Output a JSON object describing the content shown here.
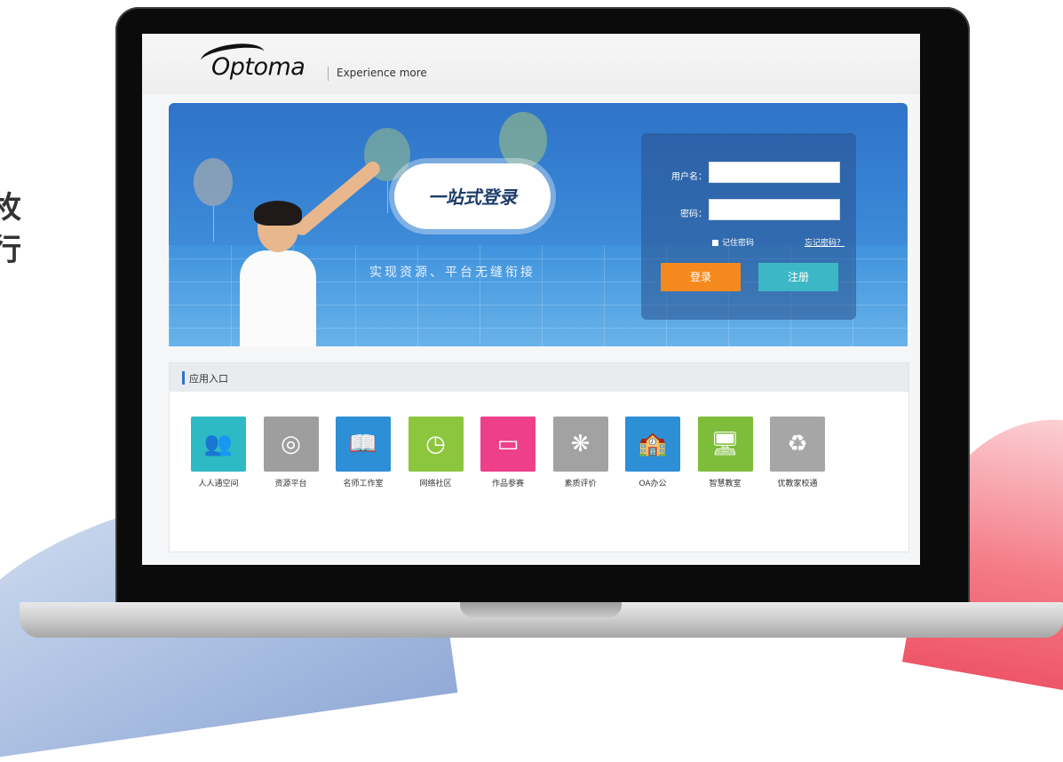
{
  "side_text": [
    "枚",
    "行"
  ],
  "header": {
    "logo": "Optoma",
    "tagline": "Experience more"
  },
  "banner": {
    "cloud_text": "一站式登录",
    "slogan": "实现资源、平台无缝衔接"
  },
  "login": {
    "username_label": "用户名：",
    "password_label": "密码：",
    "username_value": "",
    "password_value": "",
    "remember_label": "记住密码",
    "forgot_label": "忘记密码？",
    "login_button": "登录",
    "register_button": "注册"
  },
  "apps": {
    "title": "应用入口",
    "items": [
      {
        "label": "人人通空间",
        "icon": "users-icon",
        "glyph": "👥",
        "color": "#2ebac4"
      },
      {
        "label": "资源平台",
        "icon": "disc-icon",
        "glyph": "◎",
        "color": "#9e9e9e"
      },
      {
        "label": "名师工作室",
        "icon": "book-icon",
        "glyph": "📖",
        "color": "#2d8fd6"
      },
      {
        "label": "网络社区",
        "icon": "clock-icon",
        "glyph": "◷",
        "color": "#8cc63e"
      },
      {
        "label": "作品参赛",
        "icon": "monitor-icon",
        "glyph": "▭",
        "color": "#ee3f8a"
      },
      {
        "label": "素质评价",
        "icon": "flower-icon",
        "glyph": "❋",
        "color": "#a2a2a2"
      },
      {
        "label": "OA办公",
        "icon": "building-icon",
        "glyph": "🏫",
        "color": "#2d8fd6"
      },
      {
        "label": "智慧教室",
        "icon": "screen-icon",
        "glyph": "🖥",
        "color": "#7dbd3a"
      },
      {
        "label": "优教家校通",
        "icon": "recycle-icon",
        "glyph": "♻",
        "color": "#a6a6a6"
      }
    ]
  }
}
